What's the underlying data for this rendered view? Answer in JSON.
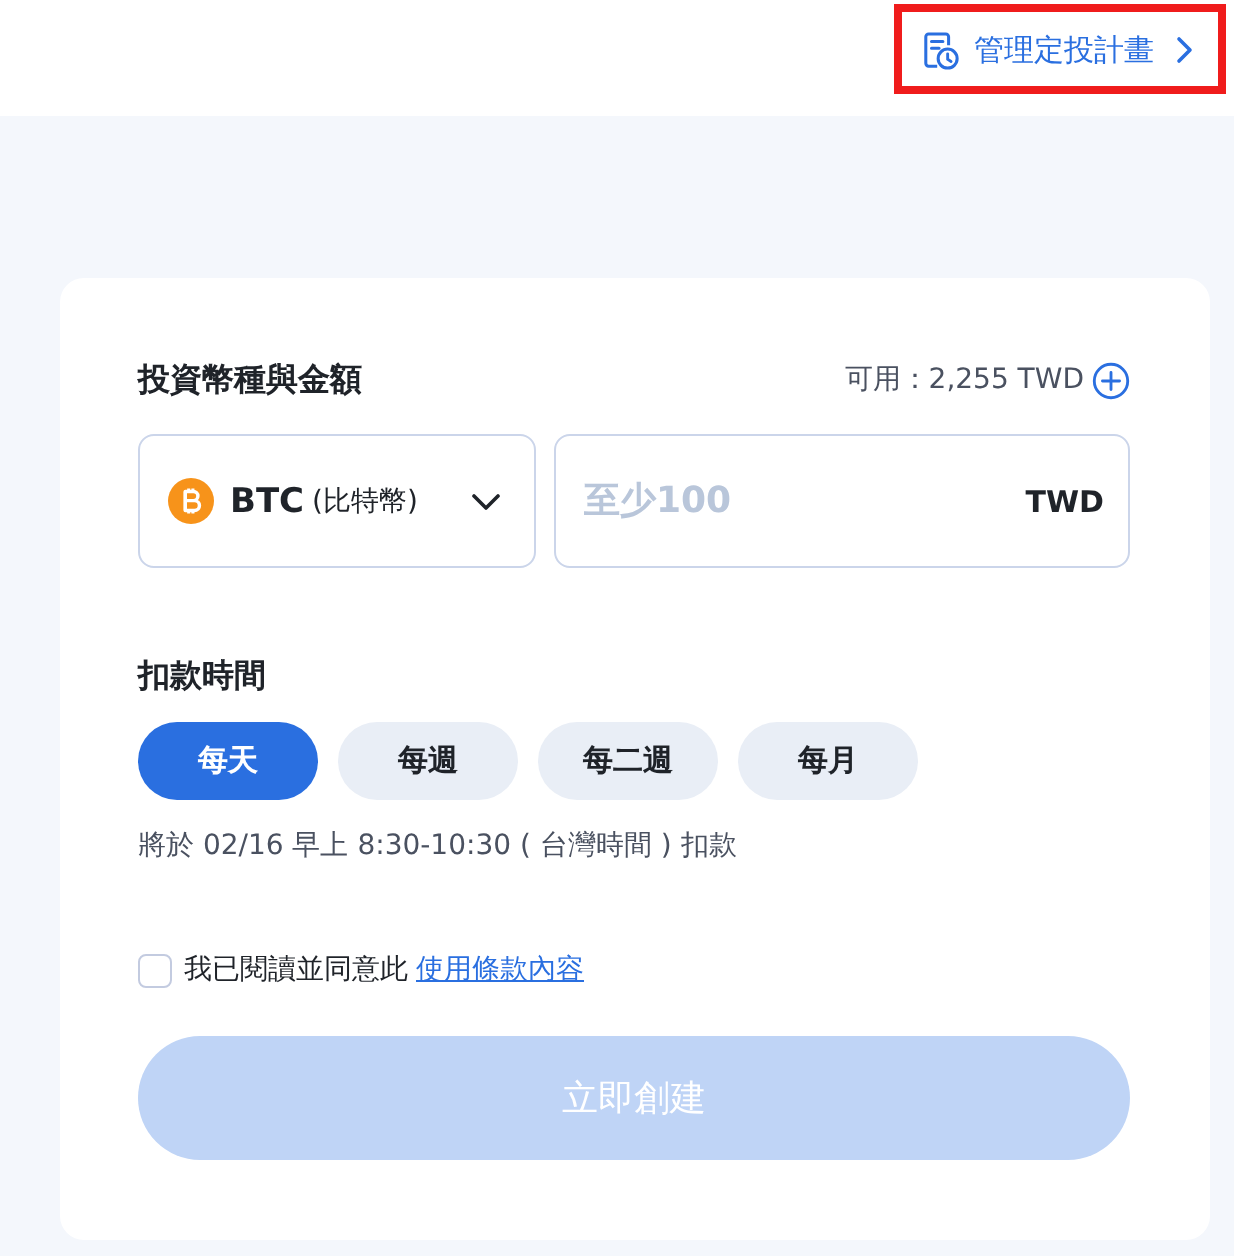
{
  "header": {
    "manage_link": {
      "label": "管理定投計畫",
      "highlighted": true
    }
  },
  "amount_section": {
    "title": "投資幣種與金額",
    "available": "可用：2,255 TWD",
    "coin_select": {
      "code": "BTC",
      "name": "(比特幣)"
    },
    "amount_field": {
      "placeholder": "至少100",
      "unit": "TWD"
    }
  },
  "schedule": {
    "title": "扣款時間",
    "options": [
      {
        "label": "每天",
        "selected": true
      },
      {
        "label": "每週",
        "selected": false
      },
      {
        "label": "每二週",
        "selected": false
      },
      {
        "label": "每月",
        "selected": false
      }
    ],
    "note": "將於 02/16 早上 8:30-10:30 ( 台灣時間 ) 扣款"
  },
  "agreement": {
    "checked": false,
    "text": "我已閱讀並同意此",
    "link": "使用條款內容"
  },
  "submit": {
    "label": "立即創建",
    "disabled": true
  }
}
